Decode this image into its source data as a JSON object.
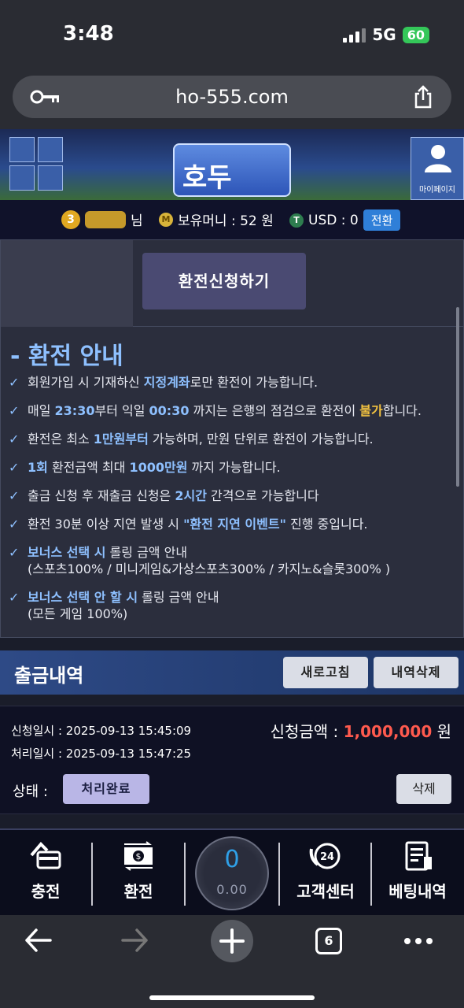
{
  "status_bar": {
    "time": "3:48",
    "network": "5G",
    "battery": "60"
  },
  "browser": {
    "url": "ho-555.com",
    "tab_count": "6"
  },
  "header": {
    "logo_text": "호두",
    "mypage_label": "마이페이지"
  },
  "user_info": {
    "level": "3",
    "name_suffix": "님",
    "money_label": "보유머니 : 52 원",
    "money_coin": "M",
    "usd_coin": "T",
    "usd_label": "USD : 0",
    "convert_button": "전환"
  },
  "exchange": {
    "apply_button": "환전신청하기",
    "guide_title": "- 환전 안내",
    "guide": [
      {
        "parts": [
          {
            "t": "회원가입 시 기재하신 ",
            "s": ""
          },
          {
            "t": "지정계좌",
            "s": "hl"
          },
          {
            "t": "로만 환전이 가능합니다.",
            "s": ""
          }
        ]
      },
      {
        "parts": [
          {
            "t": "매일 ",
            "s": ""
          },
          {
            "t": "23:30",
            "s": "hl"
          },
          {
            "t": "부터 익일 ",
            "s": ""
          },
          {
            "t": "00:30",
            "s": "hl"
          },
          {
            "t": " 까지는 은행의 점검으로 환전이 ",
            "s": ""
          },
          {
            "t": "불가",
            "s": "hl-y"
          },
          {
            "t": "합니다.",
            "s": ""
          }
        ]
      },
      {
        "parts": [
          {
            "t": "환전은 최소 ",
            "s": ""
          },
          {
            "t": "1만원부터",
            "s": "hl"
          },
          {
            "t": " 가능하며, 만원 단위로 환전이 가능합니다.",
            "s": ""
          }
        ]
      },
      {
        "parts": [
          {
            "t": "1회",
            "s": "hl"
          },
          {
            "t": " 환전금액 최대 ",
            "s": ""
          },
          {
            "t": "1000만원",
            "s": "hl"
          },
          {
            "t": " 까지 가능합니다.",
            "s": ""
          }
        ]
      },
      {
        "parts": [
          {
            "t": "출금 신청 후 재출금 신청은 ",
            "s": ""
          },
          {
            "t": "2시간",
            "s": "hl"
          },
          {
            "t": " 간격으로 가능합니다",
            "s": ""
          }
        ]
      },
      {
        "parts": [
          {
            "t": "환전 30분 이상 지연 발생 시 ",
            "s": ""
          },
          {
            "t": "\"환전 지연 이벤트\"",
            "s": "hl"
          },
          {
            "t": " 진행 중입니다.",
            "s": ""
          }
        ]
      },
      {
        "parts": [
          {
            "t": "보너스 선택 시",
            "s": "hl"
          },
          {
            "t": " 롤링 금액 안내",
            "s": ""
          }
        ],
        "sub": "(스포츠100% / 미니게임&가상스포츠300% / 카지노&슬롯300% )"
      },
      {
        "parts": [
          {
            "t": "보너스 선택 안 할 시",
            "s": "hl"
          },
          {
            "t": " 롤링 금액 안내",
            "s": ""
          }
        ],
        "sub": "(모든 게임 100%)"
      }
    ]
  },
  "history": {
    "title": "출금내역",
    "refresh_button": "새로고침",
    "delete_all_button": "내역삭제",
    "row": {
      "applied_at": "신청일시 : 2025-09-13 15:45:09",
      "processed_at": "처리일시 : 2025-09-13 15:47:25",
      "amount_label": "신청금액 : ",
      "amount_value": "1,000,000",
      "amount_unit": " 원",
      "state_label": "상태 :",
      "state_value": "처리완료",
      "delete_button": "삭제"
    }
  },
  "bottom_nav": {
    "deposit": "충전",
    "exchange": "환전",
    "balance_main": "0",
    "balance_sub": "0.00",
    "support": "고객센터",
    "bet_history": "베팅내역"
  },
  "colors": {
    "accent": "#8ec0ff",
    "warning": "#f0c040",
    "amount": "#ff5a4e"
  }
}
